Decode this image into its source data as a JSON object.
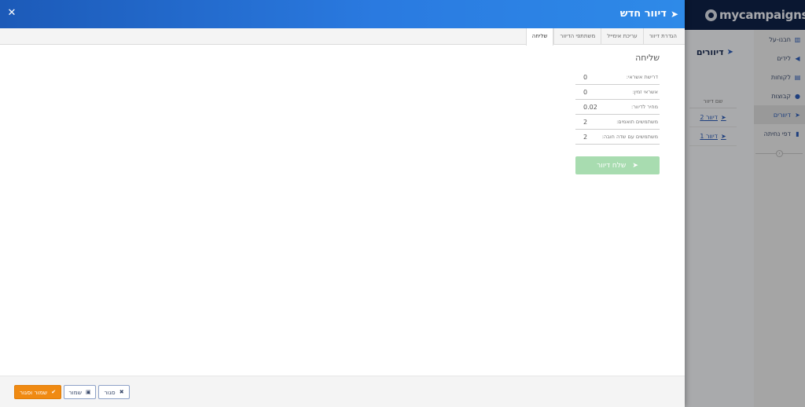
{
  "app": {
    "logo_text": "mycampaigns",
    "nav_items": [
      {
        "label": "חבנו-על",
        "icon": "chart-icon"
      },
      {
        "label": "לידים",
        "icon": "megaphone-icon"
      },
      {
        "label": "לקוחות",
        "icon": "contact-card-icon"
      },
      {
        "label": "קבוצות",
        "icon": "users-icon"
      },
      {
        "label": "דיוורים",
        "icon": "paper-plane-icon",
        "active": true
      },
      {
        "label": "דפי נחיתה",
        "icon": "file-icon"
      }
    ],
    "panel": {
      "title": "דיוורים",
      "list_header": "שם דיוור",
      "rows": [
        "דיוור 2",
        "דיוור 1"
      ]
    }
  },
  "modal": {
    "title": "דיוור חדש",
    "close_glyph": "✕",
    "tabs": [
      {
        "label": "הגדרת דיוור",
        "active": false
      },
      {
        "label": "עריכת אימייל",
        "active": false
      },
      {
        "label": "משתתפי הדיוור",
        "active": false
      },
      {
        "label": "שליחה",
        "active": true
      }
    ],
    "section_title": "שליחה",
    "stats": [
      {
        "label": "דרישת אשראי:",
        "value": "0"
      },
      {
        "label": "אשראי זמין:",
        "value": "0"
      },
      {
        "label": "מחיר לדיוור:",
        "value": "0.02"
      },
      {
        "label": "משתמשים תואמים:",
        "value": "2"
      },
      {
        "label": "משתמשים עם שדה חובה:",
        "value": "2"
      }
    ],
    "send_button_label": "שלח דיוור"
  },
  "footer": {
    "save_close_label": "שמור וסגור",
    "save_label": "שמור",
    "close_label": "סגור"
  },
  "colors": {
    "header_gradient_start": "#1c5ab8",
    "header_gradient_end": "#2e8ae8",
    "send_button": "#a8dcb0",
    "save_close_button": "#f08a12",
    "app_topbar": "#0f2147"
  }
}
